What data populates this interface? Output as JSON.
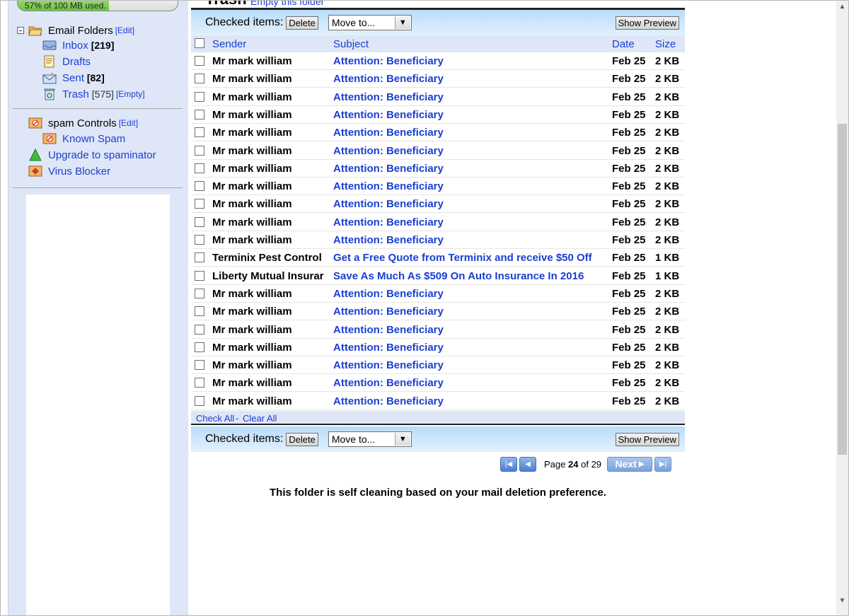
{
  "storage": {
    "usage_text": "57% of 100 MB used.",
    "percent": 57
  },
  "folders": {
    "header_label": "Email Folders",
    "edit_label": "[Edit]",
    "items": [
      {
        "label": "Inbox",
        "count": "[219]"
      },
      {
        "label": "Drafts",
        "count": ""
      },
      {
        "label": "Sent",
        "count": "[82]"
      },
      {
        "label": "Trash",
        "count": "[575]",
        "extra": "[Empty]"
      }
    ]
  },
  "spam": {
    "header_label": "spam Controls",
    "edit_label": "[Edit]",
    "known_spam": "Known Spam",
    "upgrade": "Upgrade to spaminator",
    "virus": "Virus Blocker"
  },
  "header": {
    "title": "Trash",
    "empty_link": "Empty this folder"
  },
  "toolbar": {
    "checked_items_label": "Checked items:",
    "delete_label": "Delete",
    "move_to_label": "Move to...",
    "show_preview_label": "Show Preview"
  },
  "table": {
    "columns": {
      "sender": "Sender",
      "subject": "Subject",
      "date": "Date",
      "size": "Size"
    },
    "rows": [
      {
        "sender": "Mr mark william",
        "subject": "Attention: Beneficiary",
        "date": "Feb 25",
        "size": "2 KB"
      },
      {
        "sender": "Mr mark william",
        "subject": "Attention: Beneficiary",
        "date": "Feb 25",
        "size": "2 KB"
      },
      {
        "sender": "Mr mark william",
        "subject": "Attention: Beneficiary",
        "date": "Feb 25",
        "size": "2 KB"
      },
      {
        "sender": "Mr mark william",
        "subject": "Attention: Beneficiary",
        "date": "Feb 25",
        "size": "2 KB"
      },
      {
        "sender": "Mr mark william",
        "subject": "Attention: Beneficiary",
        "date": "Feb 25",
        "size": "2 KB"
      },
      {
        "sender": "Mr mark william",
        "subject": "Attention: Beneficiary",
        "date": "Feb 25",
        "size": "2 KB"
      },
      {
        "sender": "Mr mark william",
        "subject": "Attention: Beneficiary",
        "date": "Feb 25",
        "size": "2 KB"
      },
      {
        "sender": "Mr mark william",
        "subject": "Attention: Beneficiary",
        "date": "Feb 25",
        "size": "2 KB"
      },
      {
        "sender": "Mr mark william",
        "subject": "Attention: Beneficiary",
        "date": "Feb 25",
        "size": "2 KB"
      },
      {
        "sender": "Mr mark william",
        "subject": "Attention: Beneficiary",
        "date": "Feb 25",
        "size": "2 KB"
      },
      {
        "sender": "Mr mark william",
        "subject": "Attention: Beneficiary",
        "date": "Feb 25",
        "size": "2 KB"
      },
      {
        "sender": "Terminix Pest Control",
        "subject": "Get a Free Quote from Terminix and receive $50 Off",
        "date": "Feb 25",
        "size": "1 KB"
      },
      {
        "sender": "Liberty Mutual Insurar",
        "subject": "Save As Much As $509 On Auto Insurance In 2016",
        "date": "Feb 25",
        "size": "1 KB"
      },
      {
        "sender": "Mr mark william",
        "subject": "Attention: Beneficiary",
        "date": "Feb 25",
        "size": "2 KB"
      },
      {
        "sender": "Mr mark william",
        "subject": "Attention: Beneficiary",
        "date": "Feb 25",
        "size": "2 KB"
      },
      {
        "sender": "Mr mark william",
        "subject": "Attention: Beneficiary",
        "date": "Feb 25",
        "size": "2 KB"
      },
      {
        "sender": "Mr mark william",
        "subject": "Attention: Beneficiary",
        "date": "Feb 25",
        "size": "2 KB"
      },
      {
        "sender": "Mr mark william",
        "subject": "Attention: Beneficiary",
        "date": "Feb 25",
        "size": "2 KB"
      },
      {
        "sender": "Mr mark william",
        "subject": "Attention: Beneficiary",
        "date": "Feb 25",
        "size": "2 KB"
      },
      {
        "sender": "Mr mark william",
        "subject": "Attention: Beneficiary",
        "date": "Feb 25",
        "size": "2 KB"
      }
    ]
  },
  "check_all": {
    "check_all_label": "Check All",
    "separator": "-",
    "clear_all_label": "Clear All"
  },
  "pager": {
    "page_label": "Page",
    "current": "24",
    "of_label": "of",
    "total": "29",
    "next_label": "Next"
  },
  "footer_note": "This folder is self cleaning based on your mail deletion preference.",
  "colors": {
    "link": "#1a3fd1",
    "sidebar_bg": "#dfe6f7",
    "toolbar_top": "#b9dcf9",
    "toolbar_bottom": "#e2f1fd"
  }
}
